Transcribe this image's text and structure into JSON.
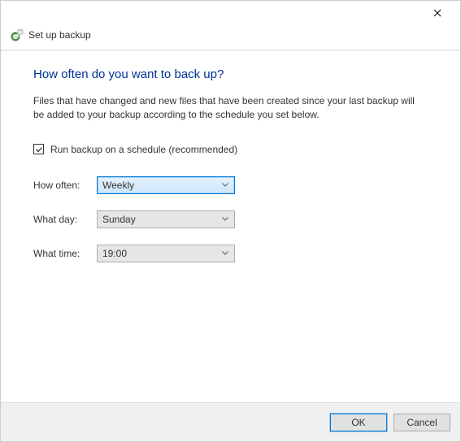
{
  "window": {
    "title": "Set up backup"
  },
  "main": {
    "heading": "How often do you want to back up?",
    "description": "Files that have changed and new files that have been created since your last backup will be added to your backup according to the schedule you set below.",
    "schedule_checkbox_label": "Run backup on a schedule (recommended)",
    "schedule_checked": true,
    "fields": {
      "how_often": {
        "label": "How often:",
        "value": "Weekly"
      },
      "what_day": {
        "label": "What day:",
        "value": "Sunday"
      },
      "what_time": {
        "label": "What time:",
        "value": "19:00"
      }
    }
  },
  "footer": {
    "ok": "OK",
    "cancel": "Cancel"
  }
}
